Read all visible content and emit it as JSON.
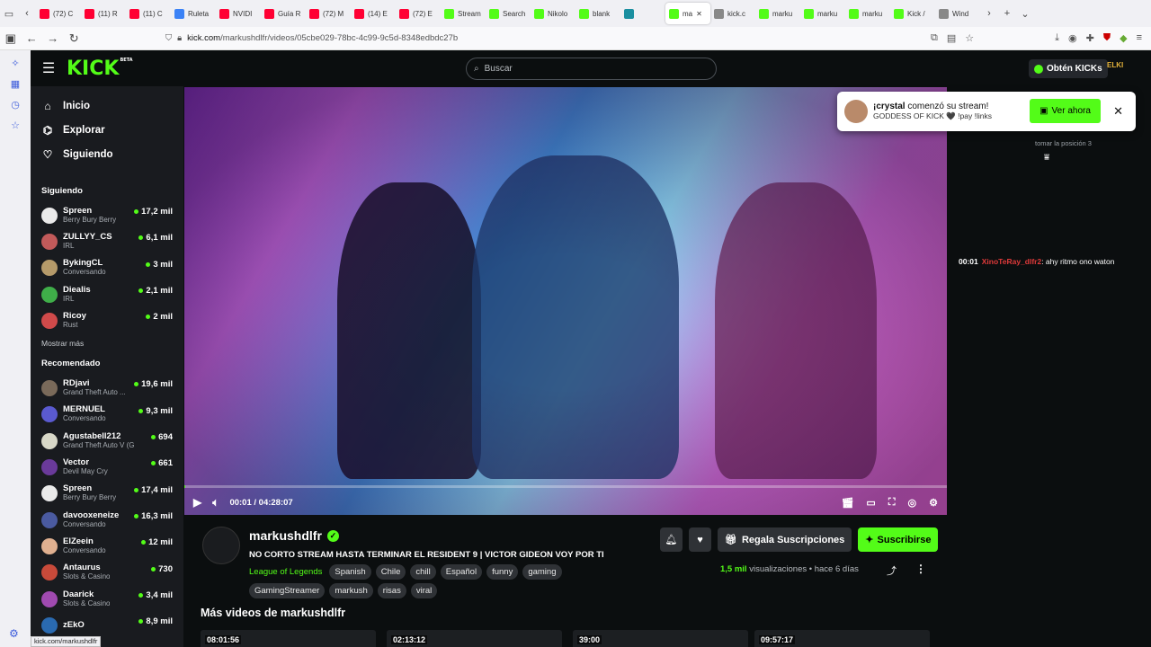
{
  "browser": {
    "tabs": [
      {
        "label": "(72) C",
        "color": "#ff0033"
      },
      {
        "label": "(11) R",
        "color": "#ff0033"
      },
      {
        "label": "(11) C",
        "color": "#ff0033"
      },
      {
        "label": "Ruleta",
        "color": "#3b82f6"
      },
      {
        "label": "NVIDI",
        "color": "#ff0033"
      },
      {
        "label": "Guía R",
        "color": "#ff0033"
      },
      {
        "label": "(72) M",
        "color": "#ff0033"
      },
      {
        "label": "(14) E",
        "color": "#ff0033"
      },
      {
        "label": "(72) E",
        "color": "#ff0033"
      },
      {
        "label": "Stream",
        "color": "#53fc18"
      },
      {
        "label": "Search",
        "color": "#53fc18"
      },
      {
        "label": "Nikolo",
        "color": "#53fc18"
      },
      {
        "label": "blank",
        "color": "#53fc18"
      },
      {
        "label": "",
        "color": "#1a8fa0"
      },
      {
        "label": "ma",
        "color": "#53fc18",
        "active": true
      },
      {
        "label": "kick.c",
        "color": "#888888"
      },
      {
        "label": "marku",
        "color": "#53fc18"
      },
      {
        "label": "marku",
        "color": "#53fc18"
      },
      {
        "label": "marku",
        "color": "#53fc18"
      },
      {
        "label": "Kick /",
        "color": "#53fc18"
      },
      {
        "label": "Wind",
        "color": "#888888"
      }
    ],
    "url_host": "kick.com",
    "url_path": "/markushdlfr/videos/05cbe029-78bc-4c99-9c5d-8348edbdc27b",
    "status_url": "kick.com/markushdlfr"
  },
  "header": {
    "logo": "KICK",
    "logo_badge": "BETA",
    "search_placeholder": "Buscar",
    "get_kicks": "Obtén KICKs",
    "user_badge": "ELKI"
  },
  "nav": {
    "main": [
      {
        "label": "Inicio",
        "icon": "home-icon"
      },
      {
        "label": "Explorar",
        "icon": "compass-icon"
      },
      {
        "label": "Siguiendo",
        "icon": "heart-icon"
      }
    ],
    "following_title": "Siguiendo",
    "following": [
      {
        "name": "Spreen",
        "category": "Berry Bury Berry",
        "viewers": "17,2 mil",
        "color": "#eaeaea"
      },
      {
        "name": "ZULLYY_CS",
        "category": "IRL",
        "viewers": "6,1 mil",
        "color": "#c25a5a"
      },
      {
        "name": "BykingCL",
        "category": "Conversando",
        "viewers": "3 mil",
        "color": "#b59a6a"
      },
      {
        "name": "Diealis",
        "category": "IRL",
        "viewers": "2,1 mil",
        "color": "#3fae49"
      },
      {
        "name": "Ricoy",
        "category": "Rust",
        "viewers": "2 mil",
        "color": "#d04a4a"
      }
    ],
    "show_more": "Mostrar más",
    "recommended_title": "Recomendado",
    "recommended": [
      {
        "name": "RDjavi",
        "category": "Grand Theft Auto ...",
        "viewers": "19,6 mil",
        "color": "#7a6a5a"
      },
      {
        "name": "MERNUEL",
        "category": "Conversando",
        "viewers": "9,3 mil",
        "color": "#5a5ad0"
      },
      {
        "name": "Agustabell212",
        "category": "Grand Theft Auto V (G...",
        "viewers": "694",
        "color": "#d8d8c8"
      },
      {
        "name": "Vector",
        "category": "Devil May Cry",
        "viewers": "661",
        "color": "#6a3a9a"
      },
      {
        "name": "Spreen",
        "category": "Berry Bury Berry",
        "viewers": "17,4 mil",
        "color": "#eaeaea"
      },
      {
        "name": "davooxeneize",
        "category": "Conversando",
        "viewers": "16,3 mil",
        "color": "#4a5aa0"
      },
      {
        "name": "ElZeein",
        "category": "Conversando",
        "viewers": "12 mil",
        "color": "#e0b090"
      },
      {
        "name": "Antaurus",
        "category": "Slots & Casino",
        "viewers": "730",
        "color": "#c84a3a"
      },
      {
        "name": "Daarick",
        "category": "Slots & Casino",
        "viewers": "3,4 mil",
        "color": "#a04ab0"
      },
      {
        "name": "zEkO",
        "category": "",
        "viewers": "8,9 mil",
        "color": "#2a6ab0"
      }
    ]
  },
  "player": {
    "current_time": "00:01",
    "duration": "04:28:07",
    "progress": 0.0001
  },
  "toast": {
    "username": "¡crystal",
    "message": " comenzó su stream!",
    "subtitle": "GODDESS OF KICK 🖤 !pay !links",
    "watch_label": "Ver ahora"
  },
  "chat": {
    "position_text": "tomar la posición 3",
    "message": {
      "time": "00:01",
      "user": "XinoTeRay_dlfr2",
      "text": ": ahy ritmo ono waton"
    }
  },
  "video_info": {
    "channel": "markushdlfr",
    "title": "NO CORTO STREAM HASTA TERMINAR EL RESIDENT 9 | VICTOR GIDEON VOY POR TI",
    "category": "League of Legends",
    "tags": [
      "Spanish",
      "Chile",
      "chill",
      "Español",
      "funny",
      "gaming",
      "GamingStreamer",
      "markush",
      "risas",
      "viral"
    ],
    "gift_label": "Regala Suscripciones",
    "subscribe_label": "Suscribirse",
    "views_count": "1,5 mil",
    "views_label": "visualizaciones",
    "age": "hace 6 días"
  },
  "more_videos": {
    "title": "Más videos de markushdlfr",
    "durations": [
      "08:01:56",
      "02:13:12",
      "39:00",
      "09:57:17"
    ]
  }
}
